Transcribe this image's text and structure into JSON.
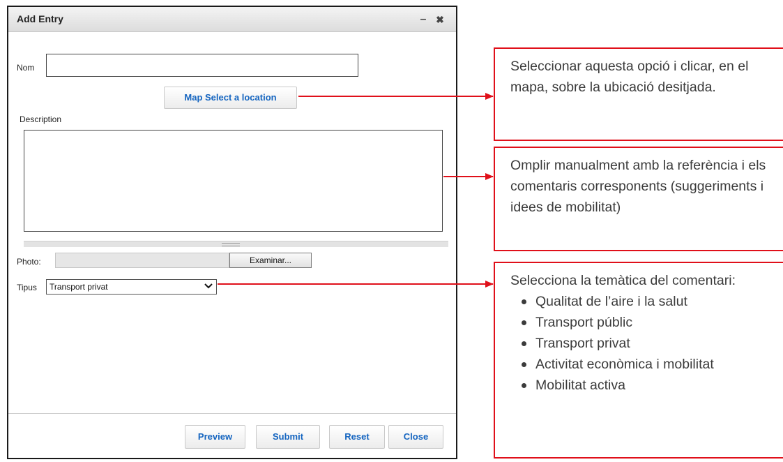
{
  "dialog": {
    "title": "Add Entry",
    "minimize_glyph": "–",
    "close_glyph": "✖",
    "name_label": "Nom",
    "name_value": "",
    "map_button": "Map Select a location",
    "description_label": "Description",
    "description_value": "",
    "photo_label": "Photo:",
    "photo_button": "Examinar...",
    "type_label": "Tipus",
    "type_selected": "Transport privat",
    "buttons": {
      "preview": "Preview",
      "submit": "Submit",
      "reset": "Reset",
      "close": "Close"
    }
  },
  "notes": {
    "location": "Seleccionar aquesta opció i clicar, en el mapa, sobre la ubicació desitjada.",
    "description": "Omplir manualment amb la referència i els comentaris corresponents (suggeriments i idees de mobilitat)",
    "topic_intro": "Selecciona la temàtica del comentari:",
    "topics": [
      "Qualitat de l’aire i la salut",
      "Transport públic",
      "Transport privat",
      "Activitat econòmica i mobilitat",
      "Mobilitat activa"
    ]
  },
  "colors": {
    "annotation_red": "#e0101a",
    "button_blue": "#1565c0"
  }
}
